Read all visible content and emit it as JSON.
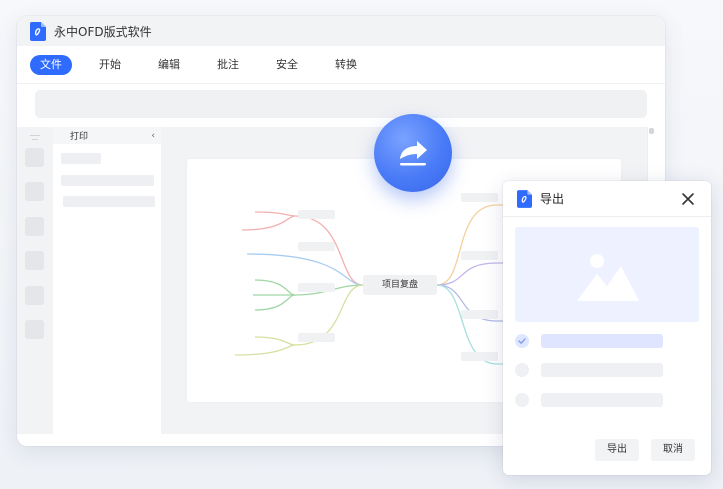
{
  "window": {
    "title": "永中OFD版式软件"
  },
  "menu": {
    "items": [
      "文件",
      "开始",
      "编辑",
      "批注",
      "安全",
      "转换"
    ],
    "active_index": 0
  },
  "panel": {
    "title": "打印",
    "collapse_glyph": "‹"
  },
  "mindmap": {
    "center_label": "项目复盘"
  },
  "dialog": {
    "title": "导出",
    "export_label": "导出",
    "cancel_label": "取消",
    "selected_option": 0
  },
  "colors": {
    "accent": "#2f6bff",
    "panel": "#f2f3f5"
  }
}
